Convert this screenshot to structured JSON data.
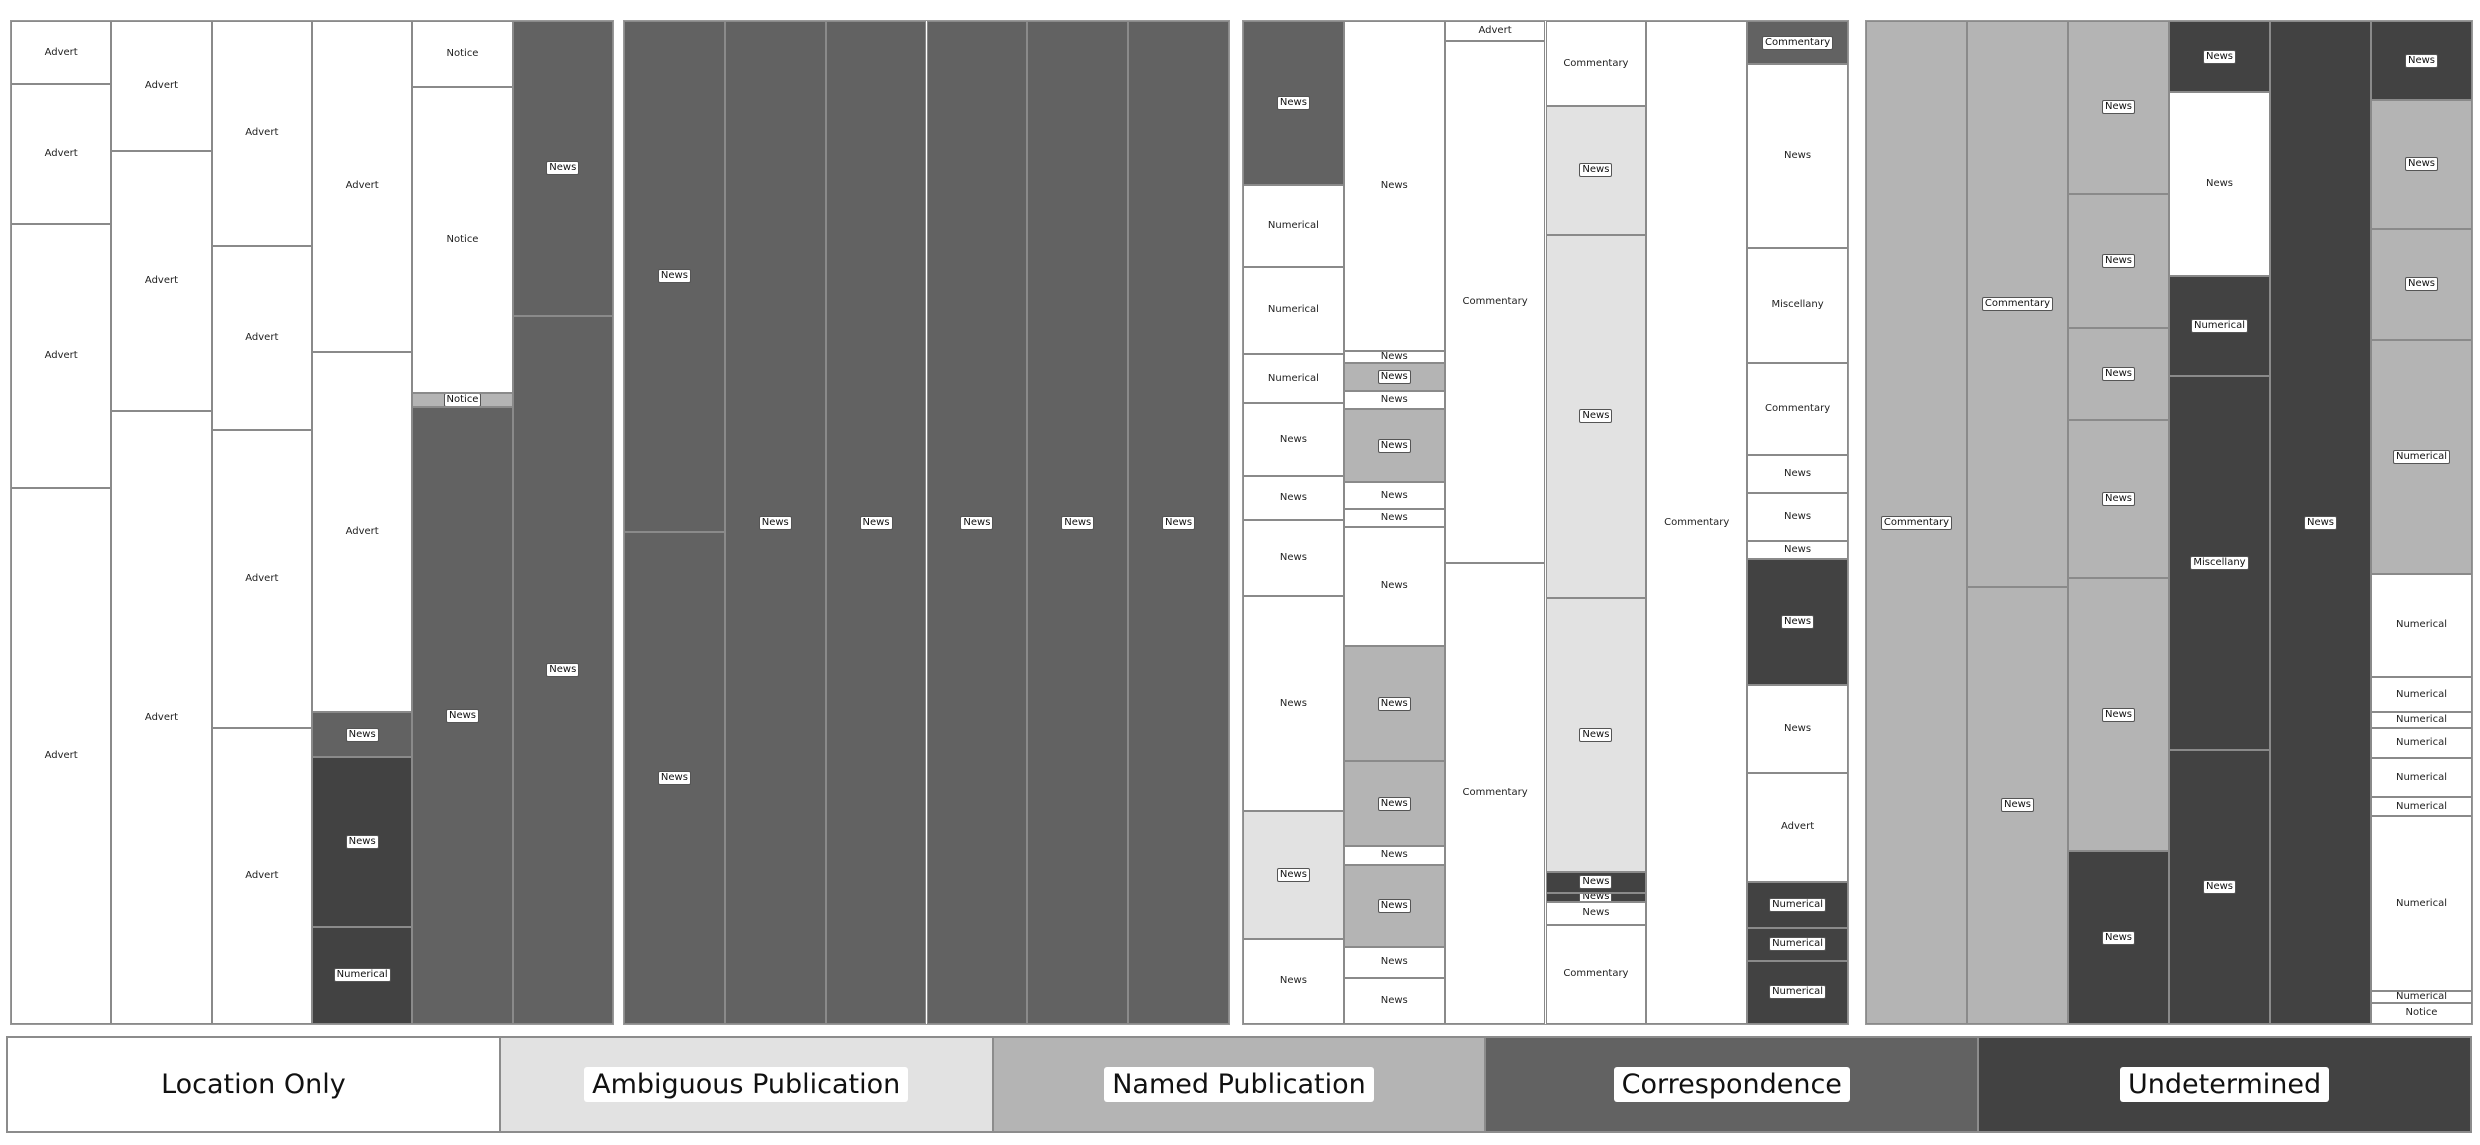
{
  "chart_data": {
    "type": "treemap-mosaic",
    "title": "",
    "categories": {
      "LO": {
        "name": "Location Only",
        "color": "#ffffff"
      },
      "AP": {
        "name": "Ambiguous Publication",
        "color": "#e2e2e2"
      },
      "NP": {
        "name": "Named Publication",
        "color": "#b4b4b4"
      },
      "CO": {
        "name": "Correspondence",
        "color": "#626262"
      },
      "UN": {
        "name": "Undetermined",
        "color": "#424242"
      }
    },
    "legend": [
      {
        "key": "LO",
        "label": "Location Only"
      },
      {
        "key": "AP",
        "label": "Ambiguous Publication"
      },
      {
        "key": "NP",
        "label": "Named Publication"
      },
      {
        "key": "CO",
        "label": "Correspondence"
      },
      {
        "key": "UN",
        "label": "Undetermined"
      }
    ],
    "legend_placement": "bottom",
    "panels": [
      {
        "columns": [
          [
            [
              "Advert",
              "LO",
              0.063
            ],
            [
              "Advert",
              "LO",
              0.202
            ],
            [
              "Advert",
              "LO",
              0.466
            ],
            [
              "Advert",
              "LO",
              1.0
            ]
          ],
          [
            [
              "Advert",
              "LO",
              0.13
            ],
            [
              "Advert",
              "LO",
              0.389
            ],
            [
              "Advert",
              "LO",
              1.0
            ]
          ],
          [
            [
              "Advert",
              "LO",
              0.224
            ],
            [
              "Advert",
              "LO",
              0.408
            ],
            [
              "Advert",
              "LO",
              0.705
            ],
            [
              "Advert",
              "LO",
              1.0
            ]
          ],
          [
            [
              "Advert",
              "LO",
              0.33
            ],
            [
              "Advert",
              "LO",
              0.689
            ],
            [
              "News",
              "CO",
              0.734
            ],
            [
              "News",
              "UN",
              0.903
            ],
            [
              "Numerical",
              "UN",
              1.0
            ]
          ],
          [
            [
              "Notice",
              "LO",
              0.066
            ],
            [
              "Notice",
              "LO",
              0.371
            ],
            [
              "Notice",
              "NP",
              0.385
            ],
            [
              "News",
              "CO",
              1.0
            ]
          ],
          [
            [
              "News",
              "CO",
              0.294
            ],
            [
              "News",
              "CO",
              1.0
            ]
          ]
        ]
      },
      {
        "columns": [
          [
            [
              "News",
              "CO",
              0.509
            ],
            [
              "News",
              "CO",
              1.0
            ]
          ],
          [
            [
              "News",
              "CO",
              1.0
            ]
          ],
          [
            [
              "News",
              "CO",
              1.0
            ]
          ],
          [
            [
              "News",
              "CO",
              1.0
            ]
          ],
          [
            [
              "News",
              "CO",
              1.0
            ]
          ],
          [
            [
              "News",
              "CO",
              1.0
            ]
          ]
        ]
      },
      {
        "columns": [
          [
            [
              "News",
              "CO",
              0.164
            ],
            [
              "Numerical",
              "LO",
              0.245
            ],
            [
              "Numerical",
              "LO",
              0.332
            ],
            [
              "Numerical",
              "LO",
              0.381
            ],
            [
              "News",
              "LO",
              0.454
            ],
            [
              "News",
              "LO",
              0.498
            ],
            [
              "News",
              "LO",
              0.573
            ],
            [
              "News",
              "LO",
              0.788
            ],
            [
              "News",
              "AP",
              0.915
            ],
            [
              "News",
              "LO",
              1.0
            ]
          ],
          [
            [
              "News",
              "LO",
              0.329
            ],
            [
              "News",
              "LO",
              0.341
            ],
            [
              "News",
              "NP",
              0.369
            ],
            [
              "News",
              "LO",
              0.387
            ],
            [
              "News",
              "NP",
              0.46
            ],
            [
              "News",
              "LO",
              0.487
            ],
            [
              "News",
              "LO",
              0.504
            ],
            [
              "News",
              "LO",
              0.623
            ],
            [
              "News",
              "NP",
              0.738
            ],
            [
              "News",
              "NP",
              0.823
            ],
            [
              "News",
              "LO",
              0.841
            ],
            [
              "News",
              "NP",
              0.923
            ],
            [
              "News",
              "LO",
              0.954
            ],
            [
              "News",
              "LO",
              1.0
            ]
          ],
          [
            [
              "Advert",
              "LO",
              0.02
            ],
            [
              "Commentary",
              "LO",
              0.54
            ],
            [
              "Commentary",
              "LO",
              1.0
            ]
          ],
          [
            [
              "Commentary",
              "LO",
              0.085
            ],
            [
              "News",
              "AP",
              0.213
            ],
            [
              "News",
              "AP",
              0.575
            ],
            [
              "News",
              "AP",
              0.848
            ],
            [
              "News",
              "UN",
              0.869
            ],
            [
              "News",
              "UN",
              0.878
            ],
            [
              "News",
              "LO",
              0.901
            ],
            [
              "Commentary",
              "LO",
              1.0
            ]
          ],
          [
            [
              "Commentary",
              "LO",
              1.0
            ]
          ],
          [
            [
              "Commentary",
              "CO",
              0.043
            ],
            [
              "News",
              "LO",
              0.226
            ],
            [
              "Miscellany",
              "LO",
              0.341
            ],
            [
              "Commentary",
              "LO",
              0.433
            ],
            [
              "News",
              "LO",
              0.471
            ],
            [
              "News",
              "LO",
              0.518
            ],
            [
              "News",
              "LO",
              0.536
            ],
            [
              "News",
              "UN",
              0.662
            ],
            [
              "News",
              "LO",
              0.75
            ],
            [
              "Advert",
              "LO",
              0.858
            ],
            [
              "Numerical",
              "UN",
              0.904
            ],
            [
              "Numerical",
              "UN",
              0.937
            ],
            [
              "Numerical",
              "UN",
              1.0
            ]
          ]
        ]
      },
      {
        "columns": [
          [
            [
              "Commentary",
              "NP",
              1.0
            ]
          ],
          [
            [
              "Commentary",
              "NP",
              0.564
            ],
            [
              "News",
              "NP",
              1.0
            ]
          ],
          [
            [
              "News",
              "NP",
              0.172
            ],
            [
              "News",
              "NP",
              0.306
            ],
            [
              "News",
              "NP",
              0.398
            ],
            [
              "News",
              "NP",
              0.555
            ],
            [
              "News",
              "NP",
              0.828
            ],
            [
              "News",
              "UN",
              1.0
            ]
          ],
          [
            [
              "News",
              "UN",
              0.071
            ],
            [
              "News",
              "LO",
              0.254
            ],
            [
              "Numerical",
              "UN",
              0.354
            ],
            [
              "Miscellany",
              "UN",
              0.727
            ],
            [
              "News",
              "UN",
              1.0
            ]
          ],
          [
            [
              "News",
              "UN",
              1.0
            ]
          ],
          [
            [
              "News",
              "UN",
              0.079
            ],
            [
              "News",
              "NP",
              0.207
            ],
            [
              "News",
              "NP",
              0.318
            ],
            [
              "Numerical",
              "NP",
              0.551
            ],
            [
              "Numerical",
              "LO",
              0.654
            ],
            [
              "Numerical",
              "LO",
              0.689
            ],
            [
              "Numerical",
              "LO",
              0.705
            ],
            [
              "Numerical",
              "LO",
              0.735
            ],
            [
              "Numerical",
              "LO",
              0.774
            ],
            [
              "Numerical",
              "LO",
              0.793
            ],
            [
              "Numerical",
              "LO",
              0.967
            ],
            [
              "Numerical",
              "LO",
              0.979
            ],
            [
              "Notice",
              "LO",
              1.0
            ]
          ]
        ]
      }
    ]
  }
}
